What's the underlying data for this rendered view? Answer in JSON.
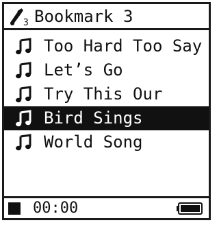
{
  "header": {
    "icon": "bookmark-music-icon",
    "bookmark_number": "3",
    "title": "Bookmark 3"
  },
  "tracks": [
    {
      "icon": "music-note-icon",
      "title": "Too Hard Too Say"
    },
    {
      "icon": "music-note-icon",
      "title": "Let’s Go"
    },
    {
      "icon": "music-note-icon",
      "title": "Try This Our"
    },
    {
      "icon": "music-note-icon",
      "title": "Bird Sings",
      "selected": true
    },
    {
      "icon": "music-note-icon",
      "title": "World Song"
    }
  ],
  "footer": {
    "status_icon": "stop-icon",
    "time": "00:00",
    "battery_icon": "battery-icon",
    "battery_level": 1.0
  },
  "colors": {
    "foreground": "#111111",
    "background": "#ffffff",
    "selection": "#111111"
  }
}
